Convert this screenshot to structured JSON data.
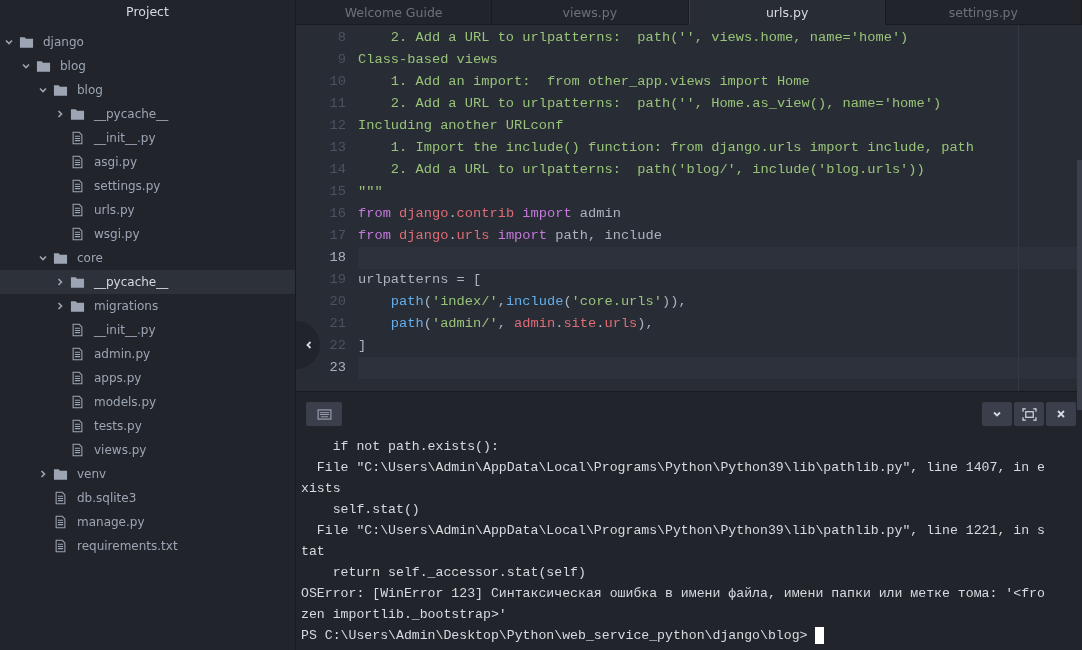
{
  "sidebar": {
    "title": "Project",
    "tree": [
      {
        "name": "django",
        "kind": "folder",
        "expanded": true,
        "selected": false,
        "children": [
          {
            "name": "blog",
            "kind": "folder",
            "expanded": true,
            "selected": false,
            "children": [
              {
                "name": "blog",
                "kind": "folder",
                "expanded": true,
                "selected": false,
                "children": [
                  {
                    "name": "__pycache__",
                    "kind": "folder",
                    "expanded": false,
                    "selected": false
                  },
                  {
                    "name": "__init__.py",
                    "kind": "file",
                    "selected": false
                  },
                  {
                    "name": "asgi.py",
                    "kind": "file",
                    "selected": false
                  },
                  {
                    "name": "settings.py",
                    "kind": "file",
                    "selected": false
                  },
                  {
                    "name": "urls.py",
                    "kind": "file",
                    "selected": false
                  },
                  {
                    "name": "wsgi.py",
                    "kind": "file",
                    "selected": false
                  }
                ]
              },
              {
                "name": "core",
                "kind": "folder",
                "expanded": true,
                "selected": false,
                "children": [
                  {
                    "name": "__pycache__",
                    "kind": "folder",
                    "expanded": false,
                    "selected": true
                  },
                  {
                    "name": "migrations",
                    "kind": "folder",
                    "expanded": false,
                    "selected": false
                  },
                  {
                    "name": "__init__.py",
                    "kind": "file",
                    "selected": false
                  },
                  {
                    "name": "admin.py",
                    "kind": "file",
                    "selected": false
                  },
                  {
                    "name": "apps.py",
                    "kind": "file",
                    "selected": false
                  },
                  {
                    "name": "models.py",
                    "kind": "file",
                    "selected": false
                  },
                  {
                    "name": "tests.py",
                    "kind": "file",
                    "selected": false
                  },
                  {
                    "name": "views.py",
                    "kind": "file",
                    "selected": false
                  }
                ]
              },
              {
                "name": "venv",
                "kind": "folder",
                "expanded": false,
                "selected": false
              },
              {
                "name": "db.sqlite3",
                "kind": "file",
                "selected": false
              },
              {
                "name": "manage.py",
                "kind": "file",
                "selected": false
              },
              {
                "name": "requirements.txt",
                "kind": "file",
                "selected": false
              }
            ]
          }
        ]
      }
    ]
  },
  "tabs": [
    {
      "label": "Welcome Guide",
      "selected": false
    },
    {
      "label": "views.py",
      "selected": false
    },
    {
      "label": "urls.py",
      "selected": true
    },
    {
      "label": "settings.py",
      "selected": false
    }
  ],
  "editor": {
    "lines": [
      {
        "number": "8",
        "highlighted": false,
        "tokens": [
          {
            "text": "    2. Add a URL to urlpatterns:  path('', views.home, name='home')",
            "kind": "doc"
          }
        ]
      },
      {
        "number": "9",
        "highlighted": false,
        "tokens": [
          {
            "text": "Class-based views",
            "kind": "doc"
          }
        ]
      },
      {
        "number": "10",
        "highlighted": false,
        "tokens": [
          {
            "text": "    1. Add an import:  from other_app.views import Home",
            "kind": "doc"
          }
        ]
      },
      {
        "number": "11",
        "highlighted": false,
        "tokens": [
          {
            "text": "    2. Add a URL to urlpatterns:  path('', Home.as_view(), name='home')",
            "kind": "doc"
          }
        ]
      },
      {
        "number": "12",
        "highlighted": false,
        "tokens": [
          {
            "text": "Including another URLconf",
            "kind": "doc"
          }
        ]
      },
      {
        "number": "13",
        "highlighted": false,
        "tokens": [
          {
            "text": "    1. Import the include() function: from django.urls import include, path",
            "kind": "doc"
          }
        ]
      },
      {
        "number": "14",
        "highlighted": false,
        "tokens": [
          {
            "text": "    2. Add a URL to urlpatterns:  path('blog/', include('blog.urls'))",
            "kind": "doc"
          }
        ]
      },
      {
        "number": "15",
        "highlighted": false,
        "tokens": [
          {
            "text": "\"\"\"",
            "kind": "doc"
          }
        ]
      },
      {
        "number": "16",
        "highlighted": false,
        "tokens": [
          {
            "text": "from ",
            "kind": "keyword"
          },
          {
            "text": "django",
            "kind": "module"
          },
          {
            "text": ".",
            "kind": "plain"
          },
          {
            "text": "contrib ",
            "kind": "module"
          },
          {
            "text": "import",
            "kind": "keyword"
          },
          {
            "text": " admin",
            "kind": "plain"
          }
        ]
      },
      {
        "number": "17",
        "highlighted": false,
        "tokens": [
          {
            "text": "from ",
            "kind": "keyword"
          },
          {
            "text": "django",
            "kind": "module"
          },
          {
            "text": ".",
            "kind": "plain"
          },
          {
            "text": "urls ",
            "kind": "module"
          },
          {
            "text": "import",
            "kind": "keyword"
          },
          {
            "text": " path, include",
            "kind": "plain"
          }
        ]
      },
      {
        "number": "18",
        "highlighted": true
      },
      {
        "number": "19",
        "highlighted": false,
        "tokens": [
          {
            "text": "urlpatterns = [",
            "kind": "plain"
          }
        ]
      },
      {
        "number": "20",
        "highlighted": false,
        "tokens": [
          {
            "text": "    path",
            "kind": "func"
          },
          {
            "text": "(",
            "kind": "plain"
          },
          {
            "text": "'index/'",
            "kind": "string"
          },
          {
            "text": ",",
            "kind": "plain"
          },
          {
            "text": "include",
            "kind": "func"
          },
          {
            "text": "(",
            "kind": "plain"
          },
          {
            "text": "'core.urls'",
            "kind": "string"
          },
          {
            "text": ")),",
            "kind": "plain"
          }
        ]
      },
      {
        "number": "21",
        "highlighted": false,
        "tokens": [
          {
            "text": "    path",
            "kind": "func"
          },
          {
            "text": "(",
            "kind": "plain"
          },
          {
            "text": "'admin/'",
            "kind": "string"
          },
          {
            "text": ", ",
            "kind": "plain"
          },
          {
            "text": "admin",
            "kind": "module"
          },
          {
            "text": ".",
            "kind": "plain"
          },
          {
            "text": "site",
            "kind": "module"
          },
          {
            "text": ".",
            "kind": "plain"
          },
          {
            "text": "urls",
            "kind": "module"
          },
          {
            "text": "),",
            "kind": "plain"
          }
        ]
      },
      {
        "number": "22",
        "highlighted": false,
        "tokens": [
          {
            "text": "]",
            "kind": "plain"
          }
        ]
      },
      {
        "number": "23",
        "highlighted": true
      }
    ]
  },
  "terminal": {
    "lines": [
      "    if not path.exists():",
      "  File \"C:\\Users\\Admin\\AppData\\Local\\Programs\\Python\\Python39\\lib\\pathlib.py\", line 1407, in e",
      "xists",
      "    self.stat()",
      "  File \"C:\\Users\\Admin\\AppData\\Local\\Programs\\Python\\Python39\\lib\\pathlib.py\", line 1221, in s",
      "tat",
      "    return self._accessor.stat(self)",
      "OSError: [WinError 123] Синтаксическая ошибка в имени файла, имени папки или метке тома: '<fro",
      "zen importlib._bootstrap>'"
    ],
    "prompt": "PS C:\\Users\\Admin\\Desktop\\Python\\web_service_python\\django\\blog> "
  }
}
